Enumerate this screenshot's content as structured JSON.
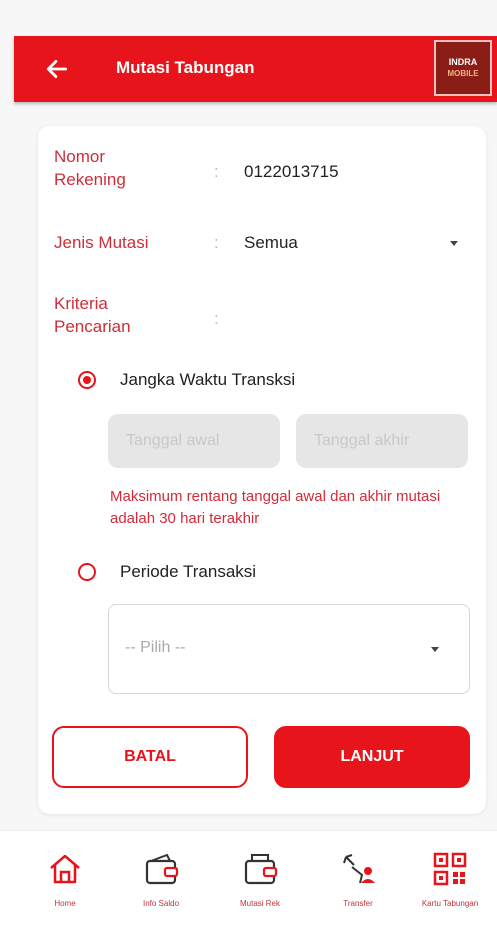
{
  "header": {
    "title": "Mutasi Tabungan",
    "logo_line1": "INDRA",
    "logo_line2": "MOBILE"
  },
  "form": {
    "account_label": "Nomor\nRekening",
    "account_value": "0122013715",
    "type_label": "Jenis Mutasi",
    "type_value": "Semua",
    "criteria_label": "Kriteria\nPencarian",
    "colon": ":",
    "option_range_label": "Jangka Waktu Transksi",
    "start_date_placeholder": "Tanggal awal",
    "end_date_placeholder": "Tanggal akhir",
    "range_note": "Maksimum rentang tanggal awal dan akhir mutasi adalah 30 hari terakhir",
    "option_period_label": "Periode Transaksi",
    "period_placeholder": "-- Pilih --",
    "selected_option": "range"
  },
  "buttons": {
    "cancel": "BATAL",
    "next": "LANJUT"
  },
  "nav": [
    {
      "label": "Home",
      "icon": "home-icon"
    },
    {
      "label": "Info Saldo",
      "icon": "wallet-icon"
    },
    {
      "label": "Mutasi Rek",
      "icon": "wallet-statement-icon"
    },
    {
      "label": "Transfer",
      "icon": "transfer-icon"
    },
    {
      "label": "Kartu Tabungan",
      "icon": "qr-code-icon"
    }
  ],
  "colors": {
    "accent": "#e8141b",
    "label": "#cc2f3a"
  }
}
